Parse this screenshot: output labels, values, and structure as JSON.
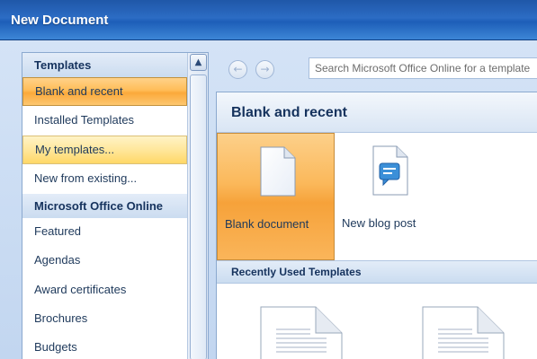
{
  "window": {
    "title": "New Document"
  },
  "sidebar": {
    "items": [
      {
        "label": "Templates",
        "kind": "header"
      },
      {
        "label": "Blank and recent",
        "kind": "selected"
      },
      {
        "label": "Installed Templates",
        "kind": "item"
      },
      {
        "label": "My templates...",
        "kind": "hover"
      },
      {
        "label": "New from existing...",
        "kind": "item"
      },
      {
        "label": "Microsoft Office Online",
        "kind": "header"
      },
      {
        "label": "Featured",
        "kind": "item"
      },
      {
        "label": "Agendas",
        "kind": "item"
      },
      {
        "label": "Award certificates",
        "kind": "item"
      },
      {
        "label": "Brochures",
        "kind": "item"
      },
      {
        "label": "Budgets",
        "kind": "item"
      }
    ]
  },
  "toolbar": {
    "back_icon": "back-arrow-icon",
    "forward_icon": "forward-arrow-icon",
    "search_placeholder": "Search Microsoft Office Online for a template"
  },
  "main": {
    "section_title": "Blank and recent",
    "tiles": [
      {
        "label": "Blank document",
        "icon": "blank-document-icon"
      },
      {
        "label": "New blog post",
        "icon": "blog-post-icon"
      }
    ],
    "recent_header": "Recently Used Templates"
  },
  "colors": {
    "title_bar": "#2c6cc4",
    "selection": "#fbb85a",
    "hover": "#ffe79b",
    "frame": "#c6d9f1"
  }
}
